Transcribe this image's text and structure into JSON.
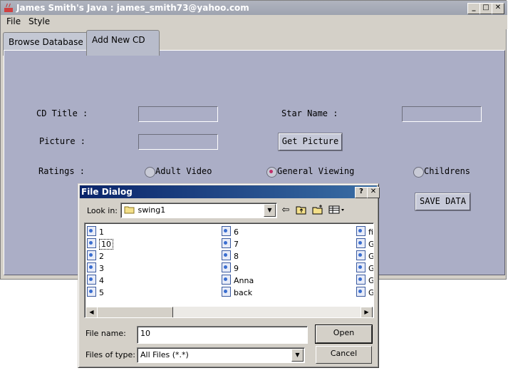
{
  "window": {
    "title": "James Smith's Java : james_smith73@yahoo.com",
    "minimize": "_",
    "maximize": "□",
    "close": "✕"
  },
  "menu": [
    "File",
    "Style"
  ],
  "tabs": [
    {
      "label": "Browse Database",
      "active": false
    },
    {
      "label": "Add New CD",
      "active": true
    }
  ],
  "form": {
    "cd_title_label": "CD Title :",
    "cd_title_value": "",
    "star_name_label": "Star Name :",
    "star_name_value": "",
    "picture_label": "Picture :",
    "picture_value": "",
    "get_picture_button": "Get Picture",
    "ratings_label": "Ratings :",
    "ratings": [
      {
        "label": "Adult Video",
        "selected": false
      },
      {
        "label": "General Viewing",
        "selected": true
      },
      {
        "label": "Childrens",
        "selected": false
      }
    ],
    "save_button": "SAVE DATA"
  },
  "dialog": {
    "title": "File Dialog",
    "help": "?",
    "close": "✕",
    "look_in_label": "Look in:",
    "look_in_value": "swing1",
    "columns": [
      [
        "1",
        "10",
        "2",
        "3",
        "4",
        "5"
      ],
      [
        "6",
        "7",
        "8",
        "9",
        "Anna",
        "back"
      ],
      [
        "fin",
        "GI",
        "GI",
        "GI",
        "GI",
        "GI"
      ]
    ],
    "selected_item": "10",
    "file_name_label": "File name:",
    "file_name_value": "10",
    "files_of_type_label": "Files of type:",
    "files_of_type_value": "All Files (*.*)",
    "open_button": "Open",
    "cancel_button": "Cancel"
  }
}
